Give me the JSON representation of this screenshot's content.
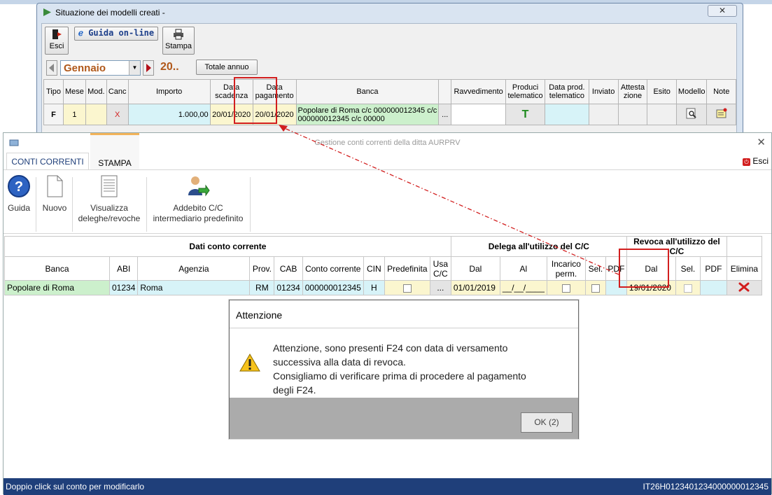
{
  "back_window": {
    "title": "Situazione dei modelli creati -",
    "toolbar": {
      "esci": "Esci",
      "guida": "Guida on-line",
      "stampa": "Stampa"
    },
    "month": "Gennaio",
    "year": "20..",
    "totale_btn": "Totale annuo",
    "columns": [
      "Tipo",
      "Mese",
      "Mod.",
      "Canc",
      "Importo",
      "Data scadenza",
      "Data pagamento",
      "Banca",
      "",
      "Ravvedimento",
      "Produci telematico",
      "Data prod. telematico",
      "Inviato",
      "Attesta zione",
      "Esito",
      "Modello",
      "Note"
    ],
    "row": {
      "tipo": "F",
      "mese": "1",
      "mod": "",
      "canc": "X",
      "importo": "1.000,00",
      "scadenza": "20/01/2020",
      "pagamento": "20/01/2020",
      "banca": "Popolare di Roma c/c 000000012345 c/c 000000012345 c/c 00000",
      "dots": "...",
      "produci": "T"
    }
  },
  "front_window": {
    "title": "Gestione conti correnti della ditta AURPRV",
    "tabs": [
      "CONTI CORRENTI",
      "STAMPA"
    ],
    "esci": "Esci",
    "ribbon": [
      {
        "label": "Guida",
        "icon": "help-icon"
      },
      {
        "label": "Nuovo",
        "icon": "new-document-icon"
      },
      {
        "label": "Visualizza deleghe/revoche",
        "icon": "list-document-icon"
      },
      {
        "label": "Addebito C/C intermediario predefinito",
        "icon": "user-transfer-icon"
      }
    ],
    "group_headers": {
      "dati": "Dati conto corrente",
      "delega": "Delega all'utilizzo del C/C",
      "revoca": "Revoca all'utilizzo del C/C"
    },
    "columns": [
      "Banca",
      "ABI",
      "Agenzia",
      "Prov.",
      "CAB",
      "Conto corrente",
      "CIN",
      "Predefinita",
      "Usa C/C",
      "Dal",
      "Al",
      "Incarico perm.",
      "Sel.",
      "PDF",
      "Dal",
      "Sel.",
      "PDF",
      "Elimina"
    ],
    "row": {
      "banca": "Popolare di Roma",
      "abi": "01234",
      "agenzia": "Roma",
      "prov": "RM",
      "cab": "01234",
      "conto": "000000012345",
      "cin": "H",
      "usa": "...",
      "delega_dal": "01/01/2019",
      "delega_al": "__/__/____",
      "revoca_dal": "19/01/2020"
    },
    "status_left": "Doppio click sul conto per modificarlo",
    "status_right": "IT26H0123401234000000012345"
  },
  "dialog": {
    "title": "Attenzione",
    "lines": [
      "Attenzione, sono presenti F24 con data di versamento",
      "successiva alla data di revoca.",
      "Consigliamo di verificare prima di procedere al pagamento",
      "degli F24."
    ],
    "ok": "OK (2)"
  },
  "colors": {
    "highlight": "#d21e1e",
    "status_bar": "#1f3f7a",
    "row_green": "#ccf0cc",
    "row_yellow": "#fbf6cf",
    "month_text": "#b0581a"
  }
}
